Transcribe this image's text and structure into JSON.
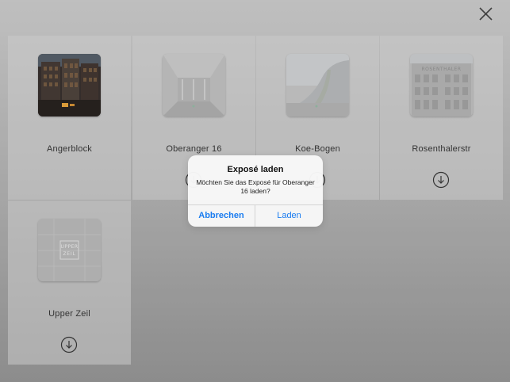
{
  "toolbar": {
    "close_icon": "close-icon"
  },
  "exposes": [
    {
      "name": "Angerblock",
      "thumb_variant": "dark-building-photo",
      "download_icon": ""
    },
    {
      "name": "Oberanger 16",
      "thumb_variant": "faded-interior-photo",
      "download_icon": "download-circle-icon"
    },
    {
      "name": "Koe-Bogen",
      "thumb_variant": "faded-curved-glass-building-photo",
      "download_icon": "download-circle-icon"
    },
    {
      "name": "Rosenthalerstr",
      "thumb_variant": "faded-facade-photo",
      "download_icon": "download-circle-icon"
    },
    {
      "name": "Upper Zeil",
      "thumb_variant": "faded-upper-zeil-logo",
      "download_icon": "download-circle-icon"
    }
  ],
  "upper_zeil_logo": {
    "line1": "UPPER",
    "line2": "ZEIL"
  },
  "rosenthaler_sign": "ROSENTHALER",
  "alert": {
    "title": "Exposé laden",
    "message": "Möchten Sie das Exposé für Oberanger 16 laden?",
    "cancel_label": "Abbrechen",
    "confirm_label": "Laden"
  },
  "colors": {
    "accent": "#1a7cf0",
    "tile_background": "#d6d6d6",
    "text": "#2a2a2a"
  }
}
